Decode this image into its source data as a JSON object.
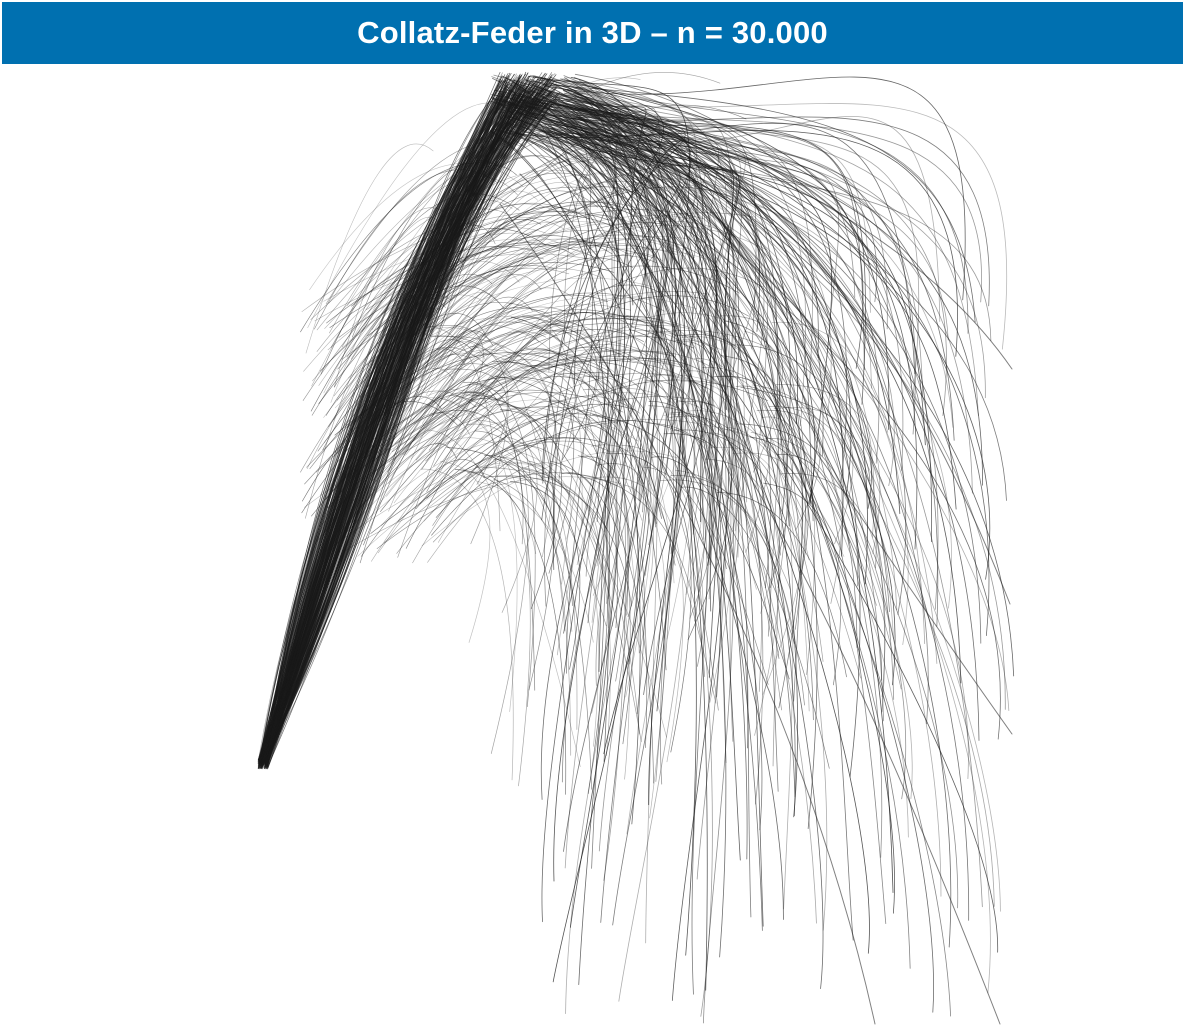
{
  "header": {
    "title": "Collatz-Feder in 3D – n = 30.000",
    "background_color": "#0070b0",
    "text_color": "#ffffff"
  },
  "visualization": {
    "stroke_color": "#1a1a1a",
    "background_color": "#ffffff"
  }
}
